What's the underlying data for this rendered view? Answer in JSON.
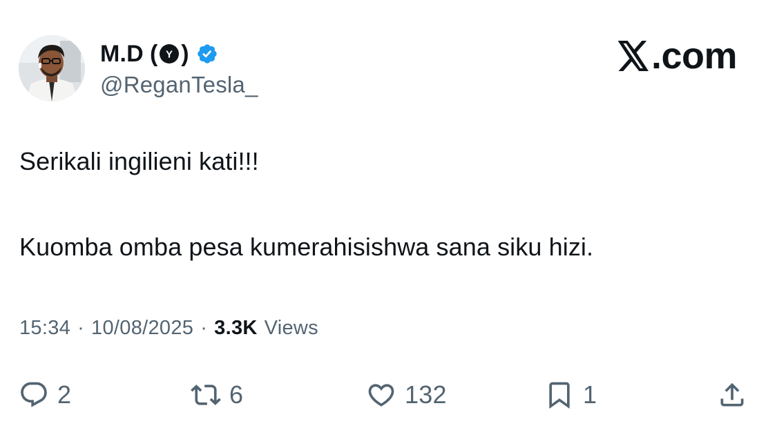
{
  "author": {
    "display_name": "M.D",
    "paren_open": "(",
    "paren_close": ")",
    "badge_icon": "circle-y-badge-icon",
    "verified_icon": "verified-badge-icon",
    "handle": "@ReganTesla_"
  },
  "brand": {
    "text": ".com",
    "logo_icon": "x-logo-icon"
  },
  "tweet": {
    "line1": "Serikali ingilieni kati!!!",
    "line2": "Kuomba omba pesa kumerahisishwa sana siku hizi."
  },
  "meta": {
    "time": "15:34",
    "separator": "·",
    "date": "10/08/2025",
    "views_count": "3.3K",
    "views_label": "Views"
  },
  "actions": {
    "reply": {
      "icon": "reply-icon",
      "count": "2"
    },
    "repost": {
      "icon": "repost-icon",
      "count": "6"
    },
    "like": {
      "icon": "heart-icon",
      "count": "132"
    },
    "bookmark": {
      "icon": "bookmark-icon",
      "count": "1"
    },
    "share": {
      "icon": "share-icon"
    }
  },
  "colors": {
    "text_primary": "#0f1419",
    "text_secondary": "#536471",
    "verified_blue": "#1d9bf0"
  }
}
